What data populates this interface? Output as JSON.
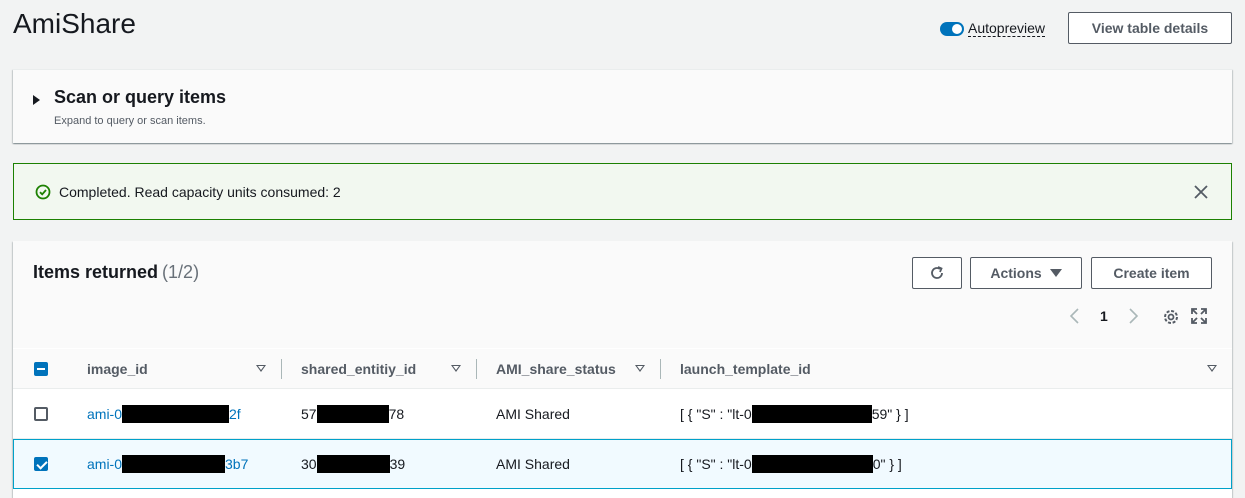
{
  "page": {
    "title": "AmiShare",
    "autopreview_label": "Autopreview",
    "autopreview_on": true,
    "view_table_details_label": "View table details"
  },
  "scan": {
    "title": "Scan or query items",
    "description": "Expand to query or scan items."
  },
  "alert": {
    "message": "Completed. Read capacity units consumed: 2",
    "status_color": "#1d8102"
  },
  "items": {
    "title": "Items returned",
    "count": "(1/2)",
    "actions_label": "Actions",
    "create_label": "Create item",
    "current_page": "1",
    "columns": [
      "image_id",
      "shared_entitiy_id",
      "AMI_share_status",
      "launch_template_id"
    ],
    "rows": [
      {
        "selected": false,
        "image_id_prefix": "ami-0",
        "image_id_suffix": "2f",
        "shared_prefix": "57",
        "shared_suffix": "78",
        "status": "AMI Shared",
        "template_prefix": "[ { \"S\" : \"lt-0",
        "template_suffix": "59\" } ]"
      },
      {
        "selected": true,
        "image_id_prefix": "ami-0",
        "image_id_suffix": "3b7",
        "shared_prefix": "30",
        "shared_suffix": "39",
        "status": "AMI Shared",
        "template_prefix": "[ { \"S\" : \"lt-0",
        "template_suffix": "0\" } ]"
      }
    ]
  },
  "icons": {
    "refresh": "refresh-icon",
    "settings": "gear-icon",
    "fullscreen": "fullscreen-icon",
    "success": "check-circle-icon",
    "close": "close-icon"
  },
  "colors": {
    "accent": "#0073bb",
    "success": "#1d8102",
    "selected_row_border": "#00a1c9"
  }
}
